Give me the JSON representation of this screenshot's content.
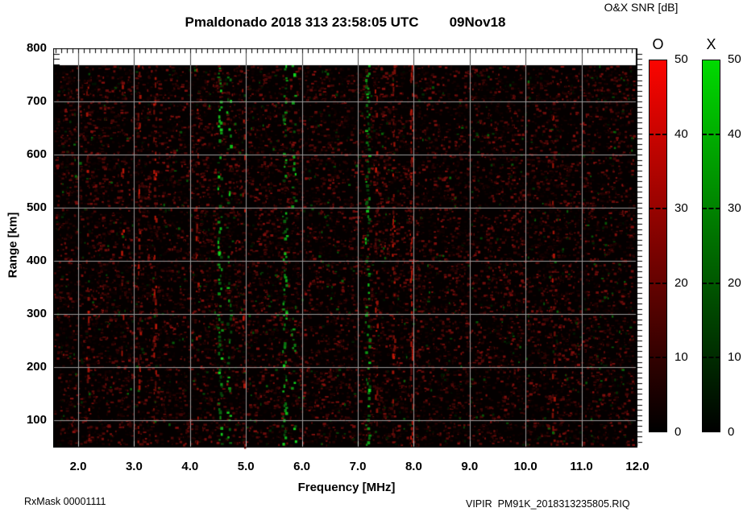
{
  "header": {
    "title": "Pmaldonado 2018 313 23:58:05 UTC",
    "date": "09Nov18"
  },
  "colorbar_panel": {
    "title": "O&X SNR [dB]",
    "bars": [
      {
        "label": "O",
        "top_color": "#fb0500",
        "bottom_color": "#000000"
      },
      {
        "label": "X",
        "top_color": "#00da00",
        "bottom_color": "#000000"
      }
    ],
    "tick_values": [
      50,
      40,
      30,
      20,
      10,
      0
    ],
    "dashed_tick_values": [
      40,
      30,
      20,
      10
    ]
  },
  "footer": {
    "left": "RxMask 00001111",
    "right": "VIPIR  PM91K_2018313235805.RIQ"
  },
  "chart_data": {
    "type": "heatmap",
    "title": "Pmaldonado 2018 313 23:58:05 UTC",
    "date_label": "09Nov18",
    "xlabel": "Frequency [MHz]",
    "ylabel": "Range [km]",
    "colorbar_title": "O&X SNR [dB]",
    "snr_scale_db": [
      0,
      50
    ],
    "xlim_mhz": [
      1.55,
      12.0
    ],
    "ylim_km": [
      49,
      800
    ],
    "x_tick_values": [
      2,
      3,
      4,
      5,
      6,
      7,
      8,
      9,
      10,
      11,
      12
    ],
    "x_tick_labels": [
      "2.0",
      "3.0",
      "4.0",
      "5.0",
      "6.0",
      "7.0",
      "8.0",
      "9.0",
      "10.0",
      "11.0",
      "12.0"
    ],
    "y_tick_values": [
      100,
      200,
      300,
      400,
      500,
      600,
      700,
      800
    ],
    "grid": true,
    "grid_color": "#9b9b9b",
    "plot_bg": "#040000",
    "no_data_band": {
      "from_km": 768,
      "to_km": 800,
      "color": "#ffffff"
    },
    "noise": {
      "seed": 1234,
      "red_speckle_count": 16000,
      "green_speckle_count": 900
    },
    "interference_bands": [
      {
        "freq_mhz": 2.16,
        "polarization": "O",
        "strength": "faint",
        "style": "streak"
      },
      {
        "freq_mhz": 2.78,
        "polarization": "O",
        "strength": "faint",
        "style": "streak"
      },
      {
        "freq_mhz": 3.08,
        "polarization": "O",
        "strength": "medium",
        "style": "streak"
      },
      {
        "freq_mhz": 3.36,
        "polarization": "O",
        "strength": "medium",
        "style": "streak"
      },
      {
        "freq_mhz": 4.12,
        "polarization": "O",
        "strength": "faint",
        "style": "streak"
      },
      {
        "freq_mhz": 4.52,
        "polarization": "X",
        "strength": "strong",
        "style": "dots"
      },
      {
        "freq_mhz": 4.68,
        "polarization": "X",
        "strength": "medium",
        "style": "dots"
      },
      {
        "freq_mhz": 4.95,
        "polarization": "O",
        "strength": "faint",
        "style": "streak"
      },
      {
        "freq_mhz": 5.68,
        "polarization": "X",
        "strength": "strong",
        "style": "dots"
      },
      {
        "freq_mhz": 5.84,
        "polarization": "X",
        "strength": "faint",
        "style": "dots"
      },
      {
        "freq_mhz": 7.16,
        "polarization": "X",
        "strength": "strong",
        "style": "dots"
      },
      {
        "freq_mhz": 7.32,
        "polarization": "O",
        "strength": "faint",
        "style": "streak"
      },
      {
        "freq_mhz": 7.63,
        "polarization": "O",
        "strength": "medium",
        "style": "streak"
      },
      {
        "freq_mhz": 7.95,
        "polarization": "O",
        "strength": "strong",
        "style": "streak"
      },
      {
        "freq_mhz": 10.48,
        "polarization": "O",
        "strength": "faint",
        "style": "streak"
      }
    ]
  }
}
